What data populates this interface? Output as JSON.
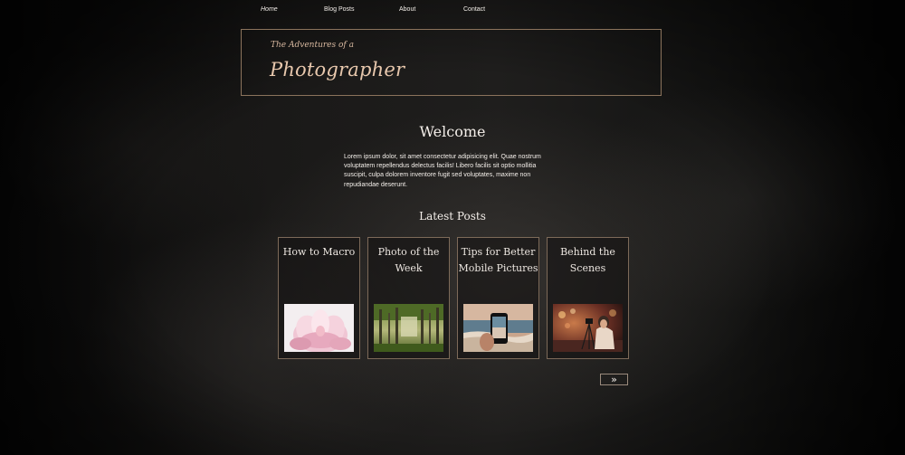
{
  "nav": {
    "items": [
      {
        "label": "Home"
      },
      {
        "label": "Blog Posts"
      },
      {
        "label": "About"
      },
      {
        "label": "Contact"
      }
    ]
  },
  "header": {
    "tagline": "The Adventures of a",
    "title": "Photographer"
  },
  "welcome": {
    "heading": "Welcome",
    "text": "Lorem ipsum dolor, sit amet consectetur adipisicing elit. Quae nostrum voluptatem repellendus delectus facilis! Libero facilis sit optio mollitia suscipit, culpa dolorem inventore fugit sed voluptates, maxime non repudiandae deserunt."
  },
  "latest_posts": {
    "heading": "Latest Posts",
    "posts": [
      {
        "title": "How to Macro",
        "image": "pink-flower-macro-photo"
      },
      {
        "title": "Photo of the Week",
        "image": "forest-trees-photo"
      },
      {
        "title": "Tips for Better Mobile Pictures",
        "image": "phone-beach-photo"
      },
      {
        "title": "Behind the Scenes",
        "image": "photographer-tripod-photo"
      }
    ],
    "next_label": "»"
  },
  "colors": {
    "accent_border": "#8b735c",
    "title_text": "#e8c8ad",
    "background": "#1a1918"
  }
}
